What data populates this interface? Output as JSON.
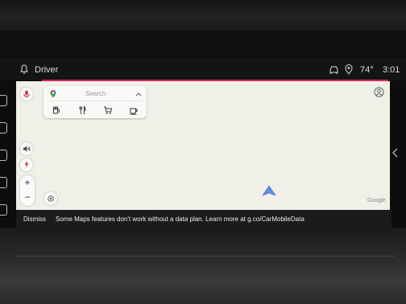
{
  "status_bar": {
    "title": "Driver",
    "temperature": "74°",
    "time": "3:01"
  },
  "search": {
    "placeholder": "Search",
    "categories": [
      "gas-station-icon",
      "restaurant-icon",
      "grocery-icon",
      "coffee-icon"
    ]
  },
  "map_controls": {
    "zoom_in": "+",
    "zoom_out": "−",
    "attribution": "Google"
  },
  "notice": {
    "dismiss_label": "Dismiss",
    "message": "Some Maps features don't work without a data plan. Learn more at g.co/CarMobileData"
  },
  "colors": {
    "accent": "#d7265a",
    "map_background": "#f0efe8",
    "nav_arrow": "#5b8de8"
  }
}
